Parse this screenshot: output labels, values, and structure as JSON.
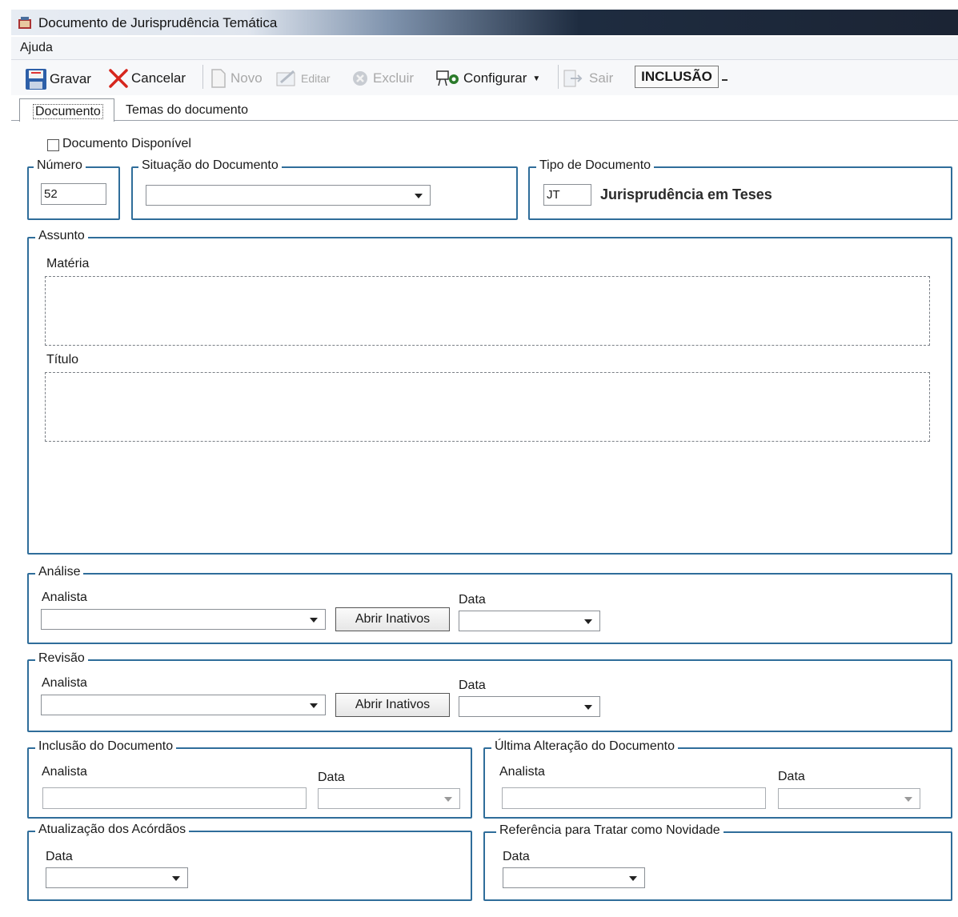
{
  "window": {
    "title": "Documento de Jurisprudência Temática"
  },
  "menu": {
    "help": "Ajuda"
  },
  "toolbar": {
    "save": "Gravar",
    "cancel": "Cancelar",
    "new": "Novo",
    "edit": "Editar",
    "delete": "Excluir",
    "configure": "Configurar",
    "exit": "Sair",
    "mode": "INCLUSÃO"
  },
  "tabs": {
    "document": "Documento",
    "themes": "Temas do documento"
  },
  "form": {
    "available_label": "Documento Disponível",
    "number": {
      "legend": "Número",
      "value": "52"
    },
    "situation": {
      "legend": "Situação do Documento",
      "value": ""
    },
    "doc_type": {
      "legend": "Tipo de Documento",
      "code": "JT",
      "name": "Jurisprudência em Teses"
    },
    "subject": {
      "legend": "Assunto",
      "matter_label": "Matéria",
      "title_label": "Título"
    },
    "analysis": {
      "legend": "Análise",
      "analyst_label": "Analista",
      "open_inactive": "Abrir Inativos",
      "date_label": "Data"
    },
    "revision": {
      "legend": "Revisão",
      "analyst_label": "Analista",
      "open_inactive": "Abrir Inativos",
      "date_label": "Data"
    },
    "inclusion": {
      "legend": "Inclusão do Documento",
      "analyst_label": "Analista",
      "date_label": "Data"
    },
    "last_change": {
      "legend": "Última Alteração do Documento",
      "analyst_label": "Analista",
      "date_label": "Data"
    },
    "rulings_update": {
      "legend": "Atualização dos Acórdãos",
      "date_label": "Data"
    },
    "novelty_ref": {
      "legend": "Referência para Tratar como Novidade",
      "date_label": "Data"
    }
  },
  "colors": {
    "group_border": "#2f6d9a",
    "title_dark": "#1b2434",
    "cancel_red": "#d6261d"
  }
}
